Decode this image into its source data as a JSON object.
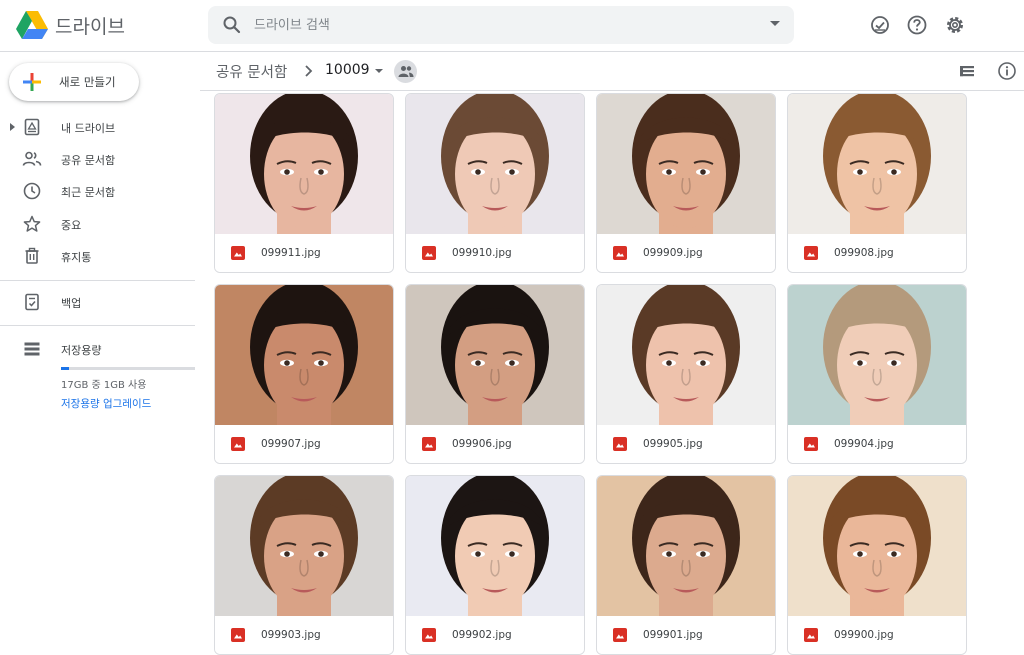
{
  "app": {
    "title": "드라이브"
  },
  "search": {
    "placeholder": "드라이브 검색"
  },
  "sidebar": {
    "new_label": "새로 만들기",
    "items": [
      {
        "label": "내 드라이브"
      },
      {
        "label": "공유 문서함"
      },
      {
        "label": "최근 문서함"
      },
      {
        "label": "중요"
      },
      {
        "label": "휴지통"
      },
      {
        "label": "백업"
      },
      {
        "label": "저장용량"
      }
    ],
    "storage": {
      "used_text": "17GB 중 1GB 사용",
      "used_fraction": 0.06,
      "upgrade_label": "저장용량 업그레이드"
    }
  },
  "breadcrumb": {
    "root": "공유 문서함",
    "current": "10009"
  },
  "colors": {
    "accent": "#1a73e8",
    "image_icon": "#d93025"
  },
  "files": [
    {
      "name": "099911.jpg",
      "bg": "#efe6ea",
      "skin": "#e7b6a0",
      "hair": "#2a1a14"
    },
    {
      "name": "099910.jpg",
      "bg": "#e9e6ec",
      "skin": "#efc9b6",
      "hair": "#6b4a35"
    },
    {
      "name": "099909.jpg",
      "bg": "#ddd8d2",
      "skin": "#e2ad8f",
      "hair": "#4a2d1d"
    },
    {
      "name": "099908.jpg",
      "bg": "#efece8",
      "skin": "#efc3a5",
      "hair": "#8a5a32"
    },
    {
      "name": "099907.jpg",
      "bg": "#c08663",
      "skin": "#c98a6c",
      "hair": "#1e1410"
    },
    {
      "name": "099906.jpg",
      "bg": "#cfc6bd",
      "skin": "#d39e82",
      "hair": "#1a1310"
    },
    {
      "name": "099905.jpg",
      "bg": "#efefef",
      "skin": "#eec2ac",
      "hair": "#5a3a26"
    },
    {
      "name": "099904.jpg",
      "bg": "#bcd2cf",
      "skin": "#f0cdb8",
      "hair": "#b49a7c"
    },
    {
      "name": "099903.jpg",
      "bg": "#d8d6d4",
      "skin": "#d9a286",
      "hair": "#5c3b25"
    },
    {
      "name": "099902.jpg",
      "bg": "#e9eaf2",
      "skin": "#f1cbb4",
      "hair": "#1c1513"
    },
    {
      "name": "099901.jpg",
      "bg": "#e3c3a3",
      "skin": "#dcaa8e",
      "hair": "#3d261a"
    },
    {
      "name": "099900.jpg",
      "bg": "#efe0cb",
      "skin": "#eab799",
      "hair": "#7a4a26"
    }
  ]
}
